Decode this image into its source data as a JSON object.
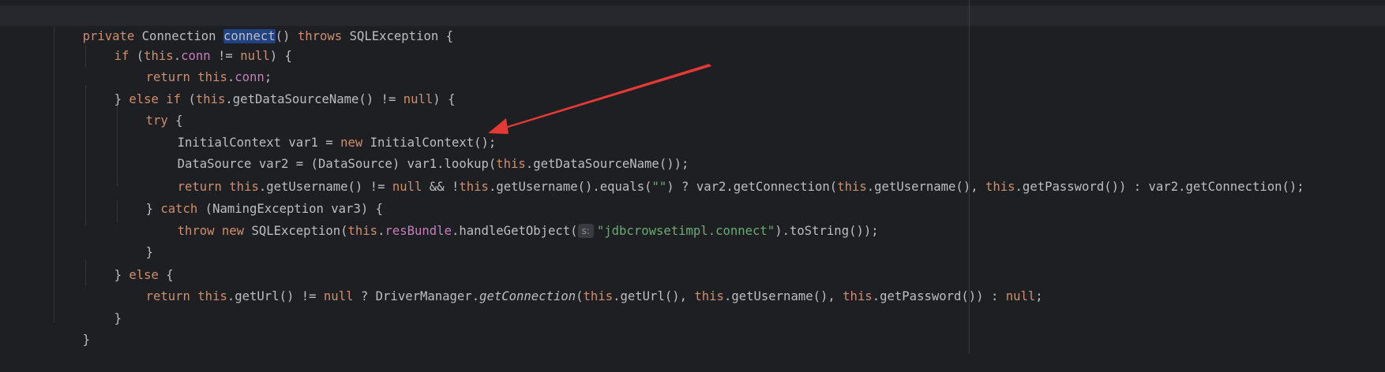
{
  "editor": {
    "lines": [
      {
        "t1": "private",
        "t2": " Connection ",
        "t3": "connect",
        "t4": "() ",
        "t5": "throws",
        "t6": " SQLException {"
      },
      {
        "t1": "if",
        "t2": " (",
        "t3": "this",
        "t4": ".",
        "t5": "conn",
        "t6": " != ",
        "t7": "null",
        "t8": ") {"
      },
      {
        "t1": "return",
        "t2": " ",
        "t3": "this",
        "t4": ".",
        "t5": "conn",
        "t6": ";"
      },
      {
        "t1": "} ",
        "t2": "else if",
        "t3": " (",
        "t4": "this",
        "t5": ".getDataSourceName() != ",
        "t6": "null",
        "t7": ") {"
      },
      {
        "t1": "try",
        "t2": " {"
      },
      {
        "t1": "InitialContext var1 = ",
        "t2": "new",
        "t3": " InitialContext();"
      },
      {
        "t1": "DataSource var2 = (DataSource) var1.lookup(",
        "t2": "this",
        "t3": ".getDataSourceName());"
      },
      {
        "t1": "return",
        "t2": " ",
        "t3": "this",
        "t4": ".getUsername() != ",
        "t5": "null",
        "t6": " && !",
        "t7": "this",
        "t8": ".getUsername().equals(",
        "t9": "\"\"",
        "t10": ") ? var2.getConnection(",
        "t11": "this",
        "t12": ".getUsername(), ",
        "t13": "this",
        "t14": ".getPassword()) : var2.getConnection();"
      },
      {
        "t1": "} ",
        "t2": "catch",
        "t3": " (NamingException var3) {"
      },
      {
        "t1": "throw",
        "t2": " ",
        "t3": "new",
        "t4": " SQLException(",
        "t5": "this",
        "t6": ".",
        "t7": "resBundle",
        "t8": ".handleGetObject(",
        "hint": "s:",
        "t9": "\"jdbcrowsetimpl.connect\"",
        "t10": ").toString());"
      },
      {
        "t1": "}"
      },
      {
        "t1": "} ",
        "t2": "else",
        "t3": " {"
      },
      {
        "t1": "return",
        "t2": " ",
        "t3": "this",
        "t4": ".getUrl() != ",
        "t5": "null",
        "t6": " ? DriverManager.",
        "t7": "getConnection",
        "t8": "(",
        "t9": "this",
        "t10": ".getUrl(), ",
        "t11": "this",
        "t12": ".getUsername(), ",
        "t13": "this",
        "t14": ".getPassword()) : ",
        "t15": "null",
        "t16": ";"
      },
      {
        "t1": "}"
      },
      {
        "t1": "}"
      }
    ]
  },
  "colors": {
    "background": "#1e1f22",
    "keyword": "#cf8e6d",
    "field": "#c77dbb",
    "string": "#6aab73",
    "plain": "#bcbec4",
    "selection": "#214283",
    "annotation_arrow": "#e53935"
  }
}
